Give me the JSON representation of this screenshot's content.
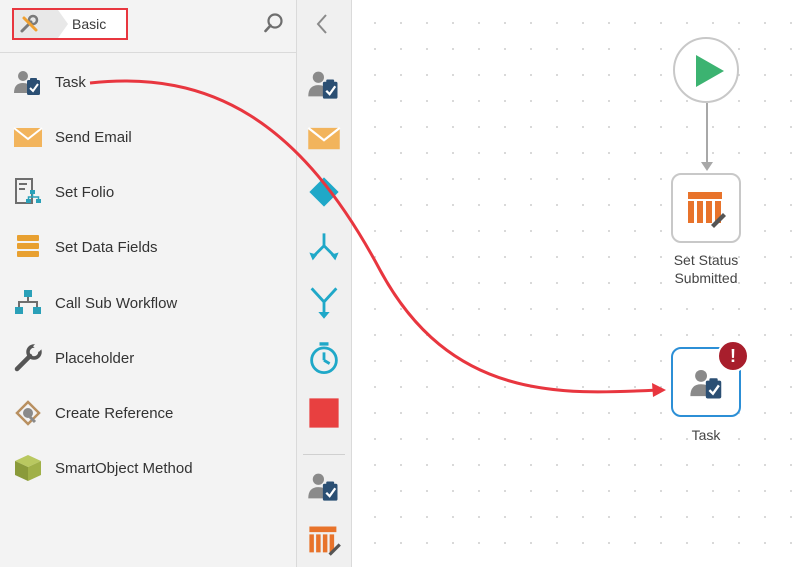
{
  "toolbox": {
    "breadcrumb_label": "Basic",
    "items": [
      {
        "label": "Task",
        "icon": "task-icon"
      },
      {
        "label": "Send Email",
        "icon": "email-icon"
      },
      {
        "label": "Set Folio",
        "icon": "folio-icon"
      },
      {
        "label": "Set Data Fields",
        "icon": "data-fields-icon"
      },
      {
        "label": "Call Sub Workflow",
        "icon": "sub-workflow-icon"
      },
      {
        "label": "Placeholder",
        "icon": "wrench-icon"
      },
      {
        "label": "Create Reference",
        "icon": "reference-icon"
      },
      {
        "label": "SmartObject Method",
        "icon": "smartobject-icon"
      }
    ]
  },
  "strip": {
    "items": [
      "task-icon",
      "email-icon",
      "decision-icon",
      "split-icon",
      "merge-icon",
      "timer-icon",
      "stop-icon",
      "task-icon",
      "data-table-icon"
    ]
  },
  "canvas": {
    "step_label_line1": "Set Status",
    "step_label_line2": "Submitted",
    "task_label": "Task",
    "error_badge": "!"
  },
  "colors": {
    "annotation_red": "#e8363f",
    "accent_blue": "#2c8fd6",
    "start_green": "#3cb371",
    "step_orange": "#e8732b",
    "error_red": "#a81e2c"
  }
}
